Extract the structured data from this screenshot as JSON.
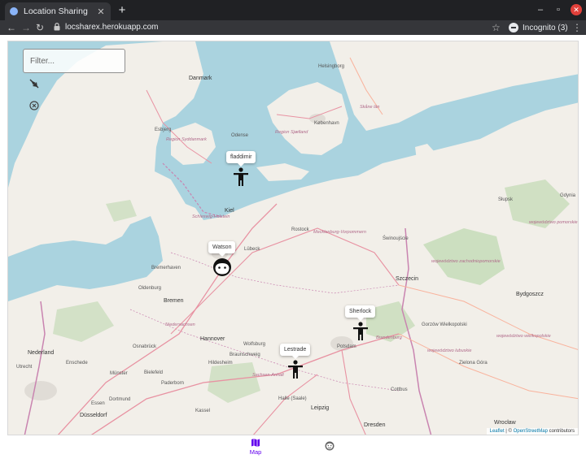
{
  "browser": {
    "tab_title": "Location Sharing",
    "url": "locsharex.herokuapp.com",
    "incognito_label": "Incognito (3)"
  },
  "map": {
    "filter_placeholder": "Filter...",
    "controls": [
      "no-location-icon",
      "clear-circle-icon"
    ],
    "markers": [
      {
        "name": "fladdimir",
        "icon": "person-icon"
      },
      {
        "name": "Watson",
        "icon": "face-icon"
      },
      {
        "name": "Sherlock",
        "icon": "person-icon"
      },
      {
        "name": "Lestrade",
        "icon": "person-icon"
      }
    ],
    "places": {
      "danmark": "Danmark",
      "helsingborg": "Helsingborg",
      "kobenhavn": "København",
      "odense": "Odense",
      "esbjerg": "Esbjerg",
      "region_syddanmark": "Region Syddanmark",
      "region_sjaelland": "Region Sjælland",
      "skane_lan": "Skåne län",
      "kiel": "Kiel",
      "lubeck": "Lübeck",
      "rostock": "Rostock",
      "schleswig_holstein": "Schleswig-Holstein",
      "mecklenburg": "Mecklenburg-Vorpommern",
      "szczecin": "Szczecin",
      "swinoujscie": "Świnoujście",
      "slupsk": "Słupsk",
      "gdynia": "Gdynia",
      "zachodniopomorskie": "województwo zachodniopomorskie",
      "pomorskie": "województwo pomorskie",
      "bremerhaven": "Bremerhaven",
      "oldenburg": "Oldenburg",
      "bremen": "Bremen",
      "niedersachsen": "Niedersachsen",
      "hannover": "Hannover",
      "osnabruck": "Osnabrück",
      "wolfsburg": "Wolfsburg",
      "braunschweig": "Braunschweig",
      "hildesheim": "Hildesheim",
      "bielefeld": "Bielefeld",
      "paderborn": "Paderborn",
      "kassel": "Kassel",
      "essen": "Essen",
      "dusseldorf": "Düsseldorf",
      "dortmund": "Dortmund",
      "munster": "Münster",
      "enschede": "Enschede",
      "nederland": "Nederland",
      "utrecht": "Utrecht",
      "halle": "Halle (Saale)",
      "leipzig": "Leipzig",
      "dresden": "Dresden",
      "potsdam": "Potsdam",
      "brandenburg": "Brandenburg",
      "cottbus": "Cottbus",
      "zielona_gora": "Zielona Góra",
      "gorzow": "Gorzów Wielkopolski",
      "wroclaw": "Wrocław",
      "bydgoszcz": "Bydgoszcz",
      "sachsen_anhalt": "Sachsen-Anhalt",
      "lubuskie": "województwo lubuskie",
      "wielkopolskie": "województwo wielkopolskie"
    },
    "attribution": {
      "leaflet": "Leaflet",
      "separator": " | © ",
      "osm": "OpenStreetMap",
      "contributors": " contributors"
    }
  },
  "bottom_nav": {
    "map_label": "Map",
    "items": [
      "map-icon",
      "face-group-icon"
    ]
  },
  "colors": {
    "accent": "#6200ee",
    "water": "#aad3df",
    "land": "#f2efe9",
    "forest": "#add19e",
    "border": "#c984b0"
  }
}
